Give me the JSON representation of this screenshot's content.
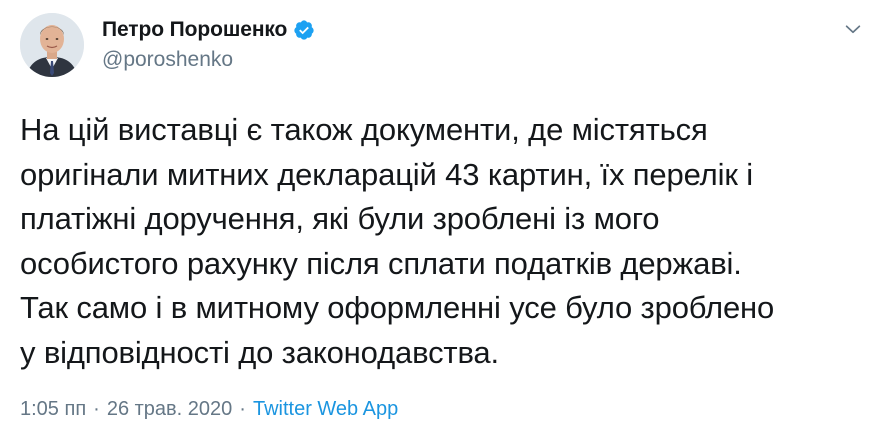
{
  "author": {
    "name": "Петро Порошенко",
    "handle": "@poroshenko",
    "verified_icon": "verified-badge-icon",
    "accent_color": "#1da1f2"
  },
  "tweet": {
    "text": "На цій виставці є також документи, де містяться\nоригінали митних декларацій 43 картин, їх перелік і\nплатіжні доручення, які були зроблені із мого\nособистого рахунку після сплати податків державі.\nТак само і в митному оформленні усе було зроблено\nу відповідності до законодавства.",
    "time": "1:05 пп",
    "date": "26 трав. 2020",
    "separator": "·",
    "source": "Twitter Web App"
  },
  "icons": {
    "menu": "chevron-down-icon"
  }
}
